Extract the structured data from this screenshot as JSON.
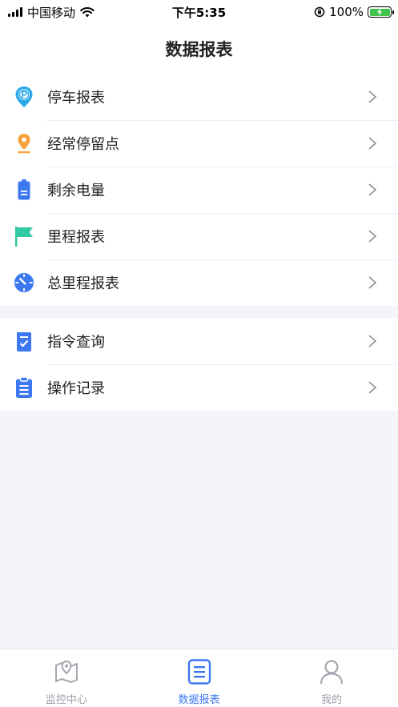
{
  "status_bar": {
    "carrier": "中国移动",
    "time": "下午5:35",
    "battery": "100%",
    "battery_level": 1.0
  },
  "header": {
    "title": "数据报表"
  },
  "menu_group_1": [
    {
      "label": "停车报表",
      "icon": "parking-pin-icon",
      "color": "#2aa9e8"
    },
    {
      "label": "经常停留点",
      "icon": "location-pin-icon",
      "color": "#f5a23b"
    },
    {
      "label": "剩余电量",
      "icon": "battery-icon",
      "color": "#3d78f0"
    },
    {
      "label": "里程报表",
      "icon": "flag-icon",
      "color": "#2fc9a4"
    },
    {
      "label": "总里程报表",
      "icon": "speedometer-icon",
      "color": "#3d78f0"
    }
  ],
  "menu_group_2": [
    {
      "label": "指令查询",
      "icon": "command-check-icon",
      "color": "#3d78f0"
    },
    {
      "label": "操作记录",
      "icon": "clipboard-list-icon",
      "color": "#3d78f0"
    }
  ],
  "tabbar": {
    "tabs": [
      {
        "label": "监控中心",
        "icon": "map-pin-icon",
        "active": false
      },
      {
        "label": "数据报表",
        "icon": "report-icon",
        "active": true
      },
      {
        "label": "我的",
        "icon": "user-icon",
        "active": false
      }
    ],
    "active_color": "#3d78f0",
    "inactive_color": "#9a9ea6"
  }
}
